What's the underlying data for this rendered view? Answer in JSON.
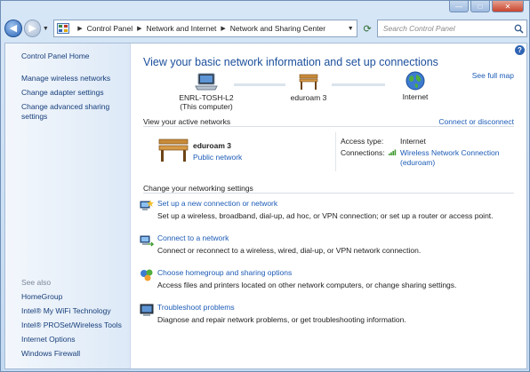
{
  "window": {
    "caption": {
      "minimize": "—",
      "maximize": "□",
      "close": "✕"
    }
  },
  "address_bar": {
    "crumbs": [
      "Control Panel",
      "Network and Internet",
      "Network and Sharing Center"
    ],
    "search_placeholder": "Search Control Panel"
  },
  "sidebar": {
    "home": "Control Panel Home",
    "links": [
      "Manage wireless networks",
      "Change adapter settings",
      "Change advanced sharing settings"
    ],
    "see_also_label": "See also",
    "see_also": [
      "HomeGroup",
      "Intel® My WiFi Technology",
      "Intel® PROSet/Wireless Tools",
      "Internet Options",
      "Windows Firewall"
    ]
  },
  "main": {
    "title": "View your basic network information and set up connections",
    "see_full_map": "See full map",
    "map": {
      "computer_name": "ENRL-TOSH-L2",
      "computer_sub": "(This computer)",
      "network_name": "eduroam  3",
      "internet": "Internet"
    },
    "active_networks": {
      "heading": "View your active networks",
      "connect_link": "Connect or disconnect",
      "name": "eduroam  3",
      "type": "Public network",
      "access_type_label": "Access type:",
      "access_type_value": "Internet",
      "connections_label": "Connections:",
      "connection_value_1": "Wireless Network Connection",
      "connection_value_2": "(eduroam)"
    },
    "settings_heading": "Change your networking settings",
    "tasks": [
      {
        "title": "Set up a new connection or network",
        "desc": "Set up a wireless, broadband, dial-up, ad hoc, or VPN connection; or set up a router or access point."
      },
      {
        "title": "Connect to a network",
        "desc": "Connect or reconnect to a wireless, wired, dial-up, or VPN network connection."
      },
      {
        "title": "Choose homegroup and sharing options",
        "desc": "Access files and printers located on other network computers, or change sharing settings."
      },
      {
        "title": "Troubleshoot problems",
        "desc": "Diagnose and repair network problems, or get troubleshooting information."
      }
    ]
  }
}
